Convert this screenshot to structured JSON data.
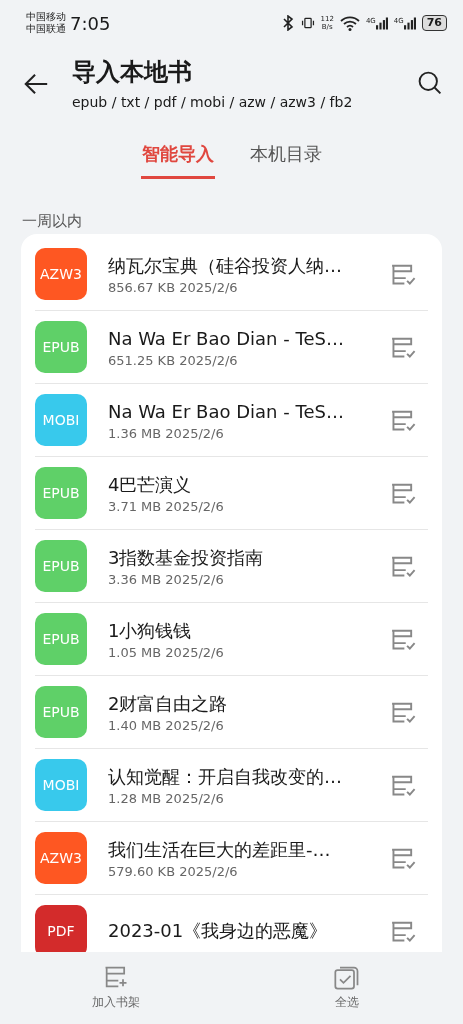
{
  "status_bar": {
    "carriers": [
      "中国移动",
      "中国联通"
    ],
    "time": "7:05",
    "net_speed": [
      "112",
      "B/s"
    ],
    "signals": [
      "4G",
      "4G"
    ],
    "battery": "76"
  },
  "header": {
    "title": "导入本地书",
    "subtitle": "epub / txt / pdf / mobi / azw / azw3 / fb2"
  },
  "tabs": [
    {
      "label": "智能导入",
      "selected": true
    },
    {
      "label": "本机目录",
      "selected": false
    }
  ],
  "section": {
    "label": "一周以内"
  },
  "files": [
    {
      "format": "AZW3",
      "color": "#fe5722",
      "name": "纳瓦尔宝典（硅谷投资人纳…",
      "meta": "856.67 KB 2025/2/6"
    },
    {
      "format": "EPUB",
      "color": "#5fd068",
      "name": "Na Wa Er Bao Dian  - TeS…",
      "meta": "651.25 KB 2025/2/6"
    },
    {
      "format": "MOBI",
      "color": "#38c9ec",
      "name": "Na Wa Er Bao Dian  - TeS…",
      "meta": "1.36 MB 2025/2/6"
    },
    {
      "format": "EPUB",
      "color": "#5fd068",
      "name": "4巴芒演义",
      "meta": "3.71 MB 2025/2/6"
    },
    {
      "format": "EPUB",
      "color": "#5fd068",
      "name": "3指数基金投资指南",
      "meta": "3.36 MB 2025/2/6"
    },
    {
      "format": "EPUB",
      "color": "#5fd068",
      "name": "1小狗钱钱",
      "meta": "1.05 MB 2025/2/6"
    },
    {
      "format": "EPUB",
      "color": "#5fd068",
      "name": "2财富自由之路",
      "meta": "1.40 MB 2025/2/6"
    },
    {
      "format": "MOBI",
      "color": "#38c9ec",
      "name": "认知觉醒：开启自我改变的…",
      "meta": "1.28 MB 2025/2/6"
    },
    {
      "format": "AZW3",
      "color": "#fe5722",
      "name": "我们生活在巨大的差距里-…",
      "meta": "579.60 KB 2025/2/6"
    },
    {
      "format": "PDF",
      "color": "#d32b2b",
      "name": "2023-01《我身边的恶魔》"
    }
  ],
  "bottom_bar": [
    {
      "kind": "add",
      "label": "加入书架"
    },
    {
      "kind": "select_all",
      "label": "全选"
    }
  ]
}
